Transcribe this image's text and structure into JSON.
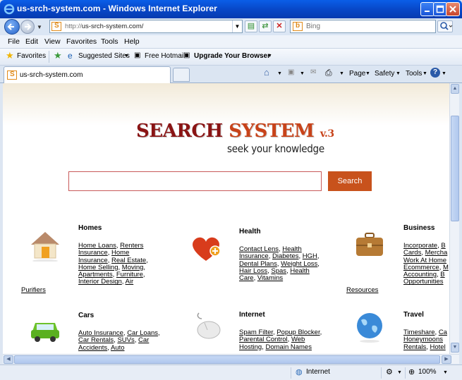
{
  "window": {
    "title": "us-srch-system.com - Windows Internet Explorer"
  },
  "address": {
    "url_prefix": "http://",
    "url_host": "us-srch-system.com/",
    "search_placeholder": "Bing"
  },
  "menu": [
    "File",
    "Edit",
    "View",
    "Favorites",
    "Tools",
    "Help"
  ],
  "favorites_bar": {
    "favorites": "Favorites",
    "suggested": "Suggested Sites",
    "hotmail": "Free Hotmail",
    "upgrade": "Upgrade Your Browser"
  },
  "tab": {
    "label": "us-srch-system.com"
  },
  "command_bar": {
    "page": "Page",
    "safety": "Safety",
    "tools": "Tools"
  },
  "page": {
    "logo_part1": "SEARCH",
    "logo_part2": "SYSTEM",
    "logo_version": "v.3",
    "tagline": "seek your knowledge",
    "search_button": "Search",
    "categories": {
      "homes": {
        "title": "Homes",
        "links": [
          "Home Loans",
          "Renters Insurance",
          "Home Insurance",
          "Real Estate",
          "Home Selling",
          "Moving",
          "Apartments",
          "Furniture",
          "Interior Design",
          "Air"
        ],
        "extra": "Purifiers"
      },
      "health": {
        "title": "Health",
        "links": [
          "Contact Lens",
          "Health Insurance",
          "Diabetes",
          "HGH",
          "Dental Plans",
          "Weight Loss",
          "Hair Loss",
          "Spas",
          "Health Care",
          "Vitamins"
        ]
      },
      "business": {
        "title": "Business",
        "links": [
          "Incorporate",
          "B",
          "Cards",
          "Mercha",
          "Work At Home",
          "Ecommerce",
          "M",
          "Accounting",
          "B",
          "Opportunities"
        ],
        "extra": "Resources"
      },
      "cars": {
        "title": "Cars",
        "links": [
          "Auto Insurance",
          "Car Loans",
          "Car Rentals",
          "SUVs",
          "Car Accidents",
          "Auto"
        ]
      },
      "internet": {
        "title": "Internet",
        "links": [
          "Spam Filter",
          "Popup Blocker",
          "Parental Control",
          "Web Hosting",
          "Domain Names"
        ]
      },
      "travel": {
        "title": "Travel",
        "links": [
          "Timeshare",
          "Ca",
          "Honeymoons",
          "Rentals",
          "Hotel"
        ]
      }
    }
  },
  "status": {
    "zone": "Internet",
    "zoom": "100%"
  },
  "colors": {
    "title_blue": "#0848c8",
    "search_button": "#c8521c",
    "logo_dark": "#8a1414",
    "logo_orange": "#c8431a"
  }
}
